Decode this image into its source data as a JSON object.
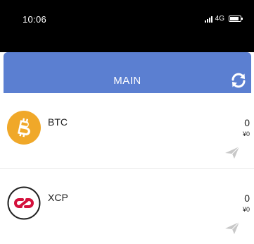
{
  "status_bar": {
    "time": "10:06",
    "network": "4G"
  },
  "header": {
    "title": "MAIN",
    "refresh_icon": "refresh-icon",
    "color": "#5b7fd1"
  },
  "wallets": [
    {
      "symbol": "BTC",
      "amount": "0",
      "fiat": "¥0",
      "icon": "bitcoin-icon",
      "icon_color": "#f0a829"
    },
    {
      "symbol": "XCP",
      "amount": "0",
      "fiat": "¥0",
      "icon": "counterparty-icon",
      "icon_color": "#d4113c"
    }
  ]
}
